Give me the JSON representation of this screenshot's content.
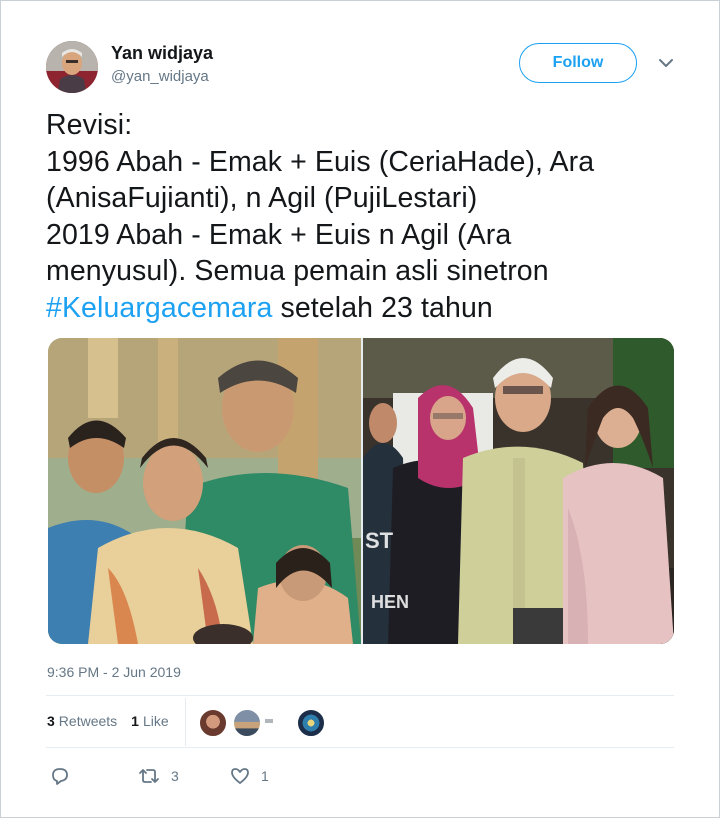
{
  "tweet": {
    "author_name": "Yan widjaya",
    "author_handle": "@yan_widjaya",
    "follow_label": "Follow",
    "text_lines": [
      "Revisi:",
      "1996 Abah - Emak + Euis (CeriaHade), Ara",
      "(AnisaFujianti), n Agil (PujiLestari)",
      "2019 Abah - Emak + Euis n Agil (Ara",
      "menyusul). Semua pemain asli sinetron"
    ],
    "last_line": {
      "hashtag": "#Keluargacemara",
      "rest": " setelah 23 tahun"
    },
    "timestamp": "9:36 PM - 2 Jun 2019",
    "retweet_count": "3",
    "retweet_label": "Retweets",
    "like_count": "1",
    "like_label": "Like",
    "reply_count": "",
    "action_retweet_count": "3",
    "action_like_count": "1"
  },
  "colors": {
    "accent": "#1da1f2",
    "secondary_text": "#657786",
    "border": "#e6ecf0"
  },
  "icons": [
    "caret-down-icon",
    "reply-icon",
    "retweet-icon",
    "heart-icon"
  ]
}
